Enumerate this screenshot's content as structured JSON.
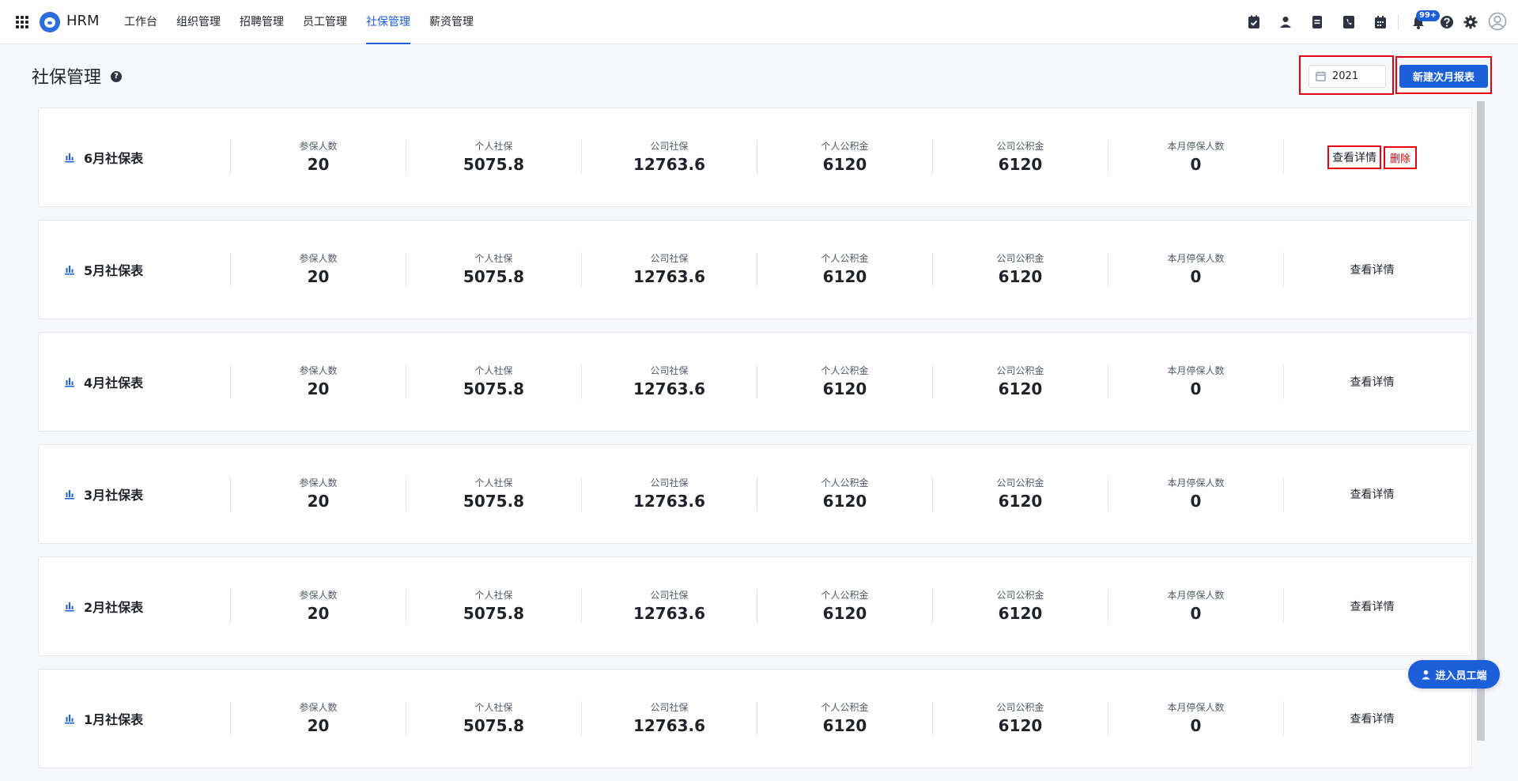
{
  "app": {
    "brand": "HRM"
  },
  "nav": {
    "items": [
      {
        "label": "工作台"
      },
      {
        "label": "组织管理"
      },
      {
        "label": "招聘管理"
      },
      {
        "label": "员工管理"
      },
      {
        "label": "社保管理",
        "active": true
      },
      {
        "label": "薪资管理"
      }
    ]
  },
  "toolbar": {
    "icons": [
      "checklist-icon",
      "person-icon",
      "document-icon",
      "phone-icon",
      "calendar-icon",
      "bell-icon",
      "help-icon",
      "gear-icon",
      "avatar-icon"
    ],
    "notification_badge": "99+"
  },
  "page": {
    "title": "社保管理",
    "year": "2021",
    "new_report_label": "新建次月报表",
    "float_button_label": "进入员工端"
  },
  "stat_labels": [
    "参保人数",
    "个人社保",
    "公司社保",
    "个人公积金",
    "公司公积金",
    "本月停保人数"
  ],
  "reports": [
    {
      "title": "6月社保表",
      "values": [
        "20",
        "5075.8",
        "12763.6",
        "6120",
        "6120",
        "0"
      ],
      "view_label": "查看详情",
      "delete_label": "删除"
    },
    {
      "title": "5月社保表",
      "values": [
        "20",
        "5075.8",
        "12763.6",
        "6120",
        "6120",
        "0"
      ],
      "view_label": "查看详情"
    },
    {
      "title": "4月社保表",
      "values": [
        "20",
        "5075.8",
        "12763.6",
        "6120",
        "6120",
        "0"
      ],
      "view_label": "查看详情"
    },
    {
      "title": "3月社保表",
      "values": [
        "20",
        "5075.8",
        "12763.6",
        "6120",
        "6120",
        "0"
      ],
      "view_label": "查看详情"
    },
    {
      "title": "2月社保表",
      "values": [
        "20",
        "5075.8",
        "12763.6",
        "6120",
        "6120",
        "0"
      ],
      "view_label": "查看详情"
    },
    {
      "title": "1月社保表",
      "values": [
        "20",
        "5075.8",
        "12763.6",
        "6120",
        "6120",
        "0"
      ],
      "view_label": "查看详情"
    }
  ],
  "colors": {
    "accent": "#1d5fd8",
    "highlight": "#e60012"
  }
}
